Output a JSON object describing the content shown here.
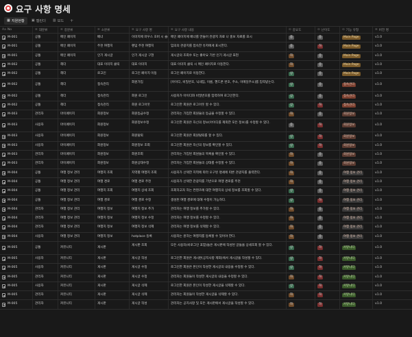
{
  "page": {
    "title": "요구 사항 명세",
    "icon": "target-icon",
    "tabs": [
      {
        "label": "지원현황",
        "icon": "table-icon",
        "active": true
      },
      {
        "label": "캘린더",
        "icon": "calendar-icon",
        "active": false
      },
      {
        "label": "보드",
        "icon": "board-icon",
        "active": false
      }
    ],
    "add_tab": "+"
  },
  "colors": {
    "background": "#191919",
    "priority": {
      "상": "#3a6b4f",
      "중": "#5a5a5a",
      "하": "#6e4a2a"
    },
    "difficulty": {
      "상": "#3a6b4f",
      "중": "#5a5a5a",
      "하": "#7a2e2e"
    },
    "category": {
      "Main Page": "#7a5a2a",
      "접속관리": "#7a3e2e",
      "회원정보": "#5a3a30",
      "여행 정보 관리": "#3a3a3a",
      "커뮤니티": "#3a5a2a"
    }
  },
  "table": {
    "columns": [
      {
        "label": "No",
        "icon": "text-icon"
      },
      {
        "label": "대분류",
        "icon": "list-icon"
      },
      {
        "label": "중분류",
        "icon": "list-icon"
      },
      {
        "label": "소분류",
        "icon": "list-icon"
      },
      {
        "label": "요구 사항 명",
        "icon": "text-icon"
      },
      {
        "label": "요구 사항 내용",
        "icon": "text-icon"
      },
      {
        "label": "중요도",
        "icon": "select-icon"
      },
      {
        "label": "난이도",
        "icon": "select-icon"
      },
      {
        "label": "기능 유형",
        "icon": "select-icon"
      },
      {
        "label": "버전 명",
        "icon": "text-icon"
      }
    ],
    "rows": [
      {
        "no": "M-001",
        "major": "공통",
        "mid": "메인 페이지",
        "minor": "배너",
        "name": "이미지에 마우스 호버 시 슬라이드 기능",
        "desc": "메인 페이지에 배너를 만들어 관광지 자료 나 홍보 자료를 표시",
        "prio": "중",
        "diff": "중",
        "type": "Main Page",
        "ver": "v1.0"
      },
      {
        "no": "M-001",
        "major": "공통",
        "mid": "메인 페이지",
        "minor": "주천 여행지",
        "name": "랜덤 주천 여행지",
        "desc": "임의의 관광지를 접속한 유저에게 표시한다.",
        "prio": "중",
        "diff": "하",
        "type": "Main Page",
        "ver": "v1.0"
      },
      {
        "no": "M-001",
        "major": "공통",
        "mid": "메인 페이지",
        "minor": "인기 게시글",
        "name": "인기 게시글 구현",
        "desc": "게시글의 조회수 또는 좋아요 기반 인기 게시글 표현",
        "prio": "하",
        "diff": "중",
        "type": "Main Page",
        "ver": "v1.0"
      },
      {
        "no": "M-002",
        "major": "공통",
        "mid": "헤더",
        "minor": "대표 이미지 클릭",
        "name": "대표 이미지",
        "desc": "대표 이미지 클릭 시 메인 페이지로 이동한다.",
        "prio": "하",
        "diff": "중",
        "type": "Main Page",
        "ver": "v1.0"
      },
      {
        "no": "M-002",
        "major": "공통",
        "mid": "헤더",
        "minor": "로고인",
        "name": "로그인 페이지 이동",
        "desc": "로그인 페이지로 이동한다.",
        "prio": "상",
        "diff": "중",
        "type": "Main Page",
        "ver": "v1.0"
      },
      {
        "no": "M-002",
        "major": "공통",
        "mid": "헤더",
        "minor": "접속관리",
        "name": "회원가입",
        "desc": "[아이디, 비밀번호, 닉네임, 이름, 핸드폰 번호, 주소, 이메일주소]를 입력받는다.",
        "prio": "상",
        "diff": "중",
        "type": "접속관리",
        "ver": "v1.0",
        "tall": true
      },
      {
        "no": "M-002",
        "major": "공통",
        "mid": "헤더",
        "minor": "접속관리",
        "name": "회원 로그인",
        "desc": "사용자가 아이디와 비밀번호를 입력하여 로그인한다.",
        "prio": "상",
        "diff": "중",
        "type": "접속관리",
        "ver": "v1.0"
      },
      {
        "no": "M-002",
        "major": "공통",
        "mid": "헤더",
        "minor": "접속관리",
        "name": "회원 로그아웃",
        "desc": "로그인한 회원은 로그아웃 할 수 있다.",
        "prio": "상",
        "diff": "하",
        "type": "접속관리",
        "ver": "v1.0"
      },
      {
        "no": "M-003",
        "major": "관리자",
        "mid": "마이페이지",
        "minor": "회원정보",
        "name": "회원등급수정",
        "desc": "관리자는 가입한 회원들의 등급을 수정할 수 있다.",
        "prio": "하",
        "diff": "중",
        "type": "회원정보",
        "ver": "v1.0"
      },
      {
        "no": "M-003",
        "major": "사용자",
        "mid": "마이페이지",
        "minor": "회원정보",
        "name": "회원정보수정",
        "desc": "로그인한 회원은 자신의 정보(아이디를 제외한 모든 정보)를 수정할 수 있다.",
        "prio": "중",
        "diff": "하",
        "type": "회원정보",
        "ver": "v1.0",
        "tall": true
      },
      {
        "no": "M-003",
        "major": "사용자",
        "mid": "마이페이지",
        "minor": "회원정보",
        "name": "회원탈퇴",
        "desc": "로그인한 회원은 회원탈퇴를 할 수 있다.",
        "prio": "상",
        "diff": "하",
        "type": "회원정보",
        "ver": "v1.0"
      },
      {
        "no": "M-003",
        "major": "사용자",
        "mid": "마이페이지",
        "minor": "회원정보",
        "name": "회원정보 조회",
        "desc": "로그인한 회원은 자신의 정보를 확인할 수 있다.",
        "prio": "상",
        "diff": "하",
        "type": "회원정보",
        "ver": "v1.0"
      },
      {
        "no": "M-003",
        "major": "관리자",
        "mid": "마이페이지",
        "minor": "회원정보",
        "name": "회원조회",
        "desc": "관리자는 가입된 회원들의 목록을 확인할 수 있다.",
        "prio": "하",
        "diff": "중",
        "type": "회원정보",
        "ver": "v1.0"
      },
      {
        "no": "M-003",
        "major": "관리자",
        "mid": "마이페이지",
        "minor": "회원정보",
        "name": "회원상태수정",
        "desc": "관리자는 가입한 회원들의 상태를 수정할 수 있다.",
        "prio": "하",
        "diff": "중",
        "type": "회원정보",
        "ver": "v1.0"
      },
      {
        "no": "M-004",
        "major": "공통",
        "mid": "여행 정보 관리",
        "minor": "여행지 조회",
        "name": "지역별 여행지 조회",
        "desc": "사용자가 선택한 지역에 따라 오구된 명세에 따른 관광지를 출력한다.",
        "prio": "하",
        "diff": "중",
        "type": "여행 정보 관리",
        "ver": "v1.0"
      },
      {
        "no": "M-004",
        "major": "공통",
        "mid": "여행 정보 관리",
        "minor": "여행 경로",
        "name": "여행 경로 주천",
        "desc": "사용자가 선택한 관광지를 기반으로 여행 경로를 주천",
        "prio": "하",
        "diff": "중",
        "type": "여행 정보 관리",
        "ver": "v1.0"
      },
      {
        "no": "M-004",
        "major": "공통",
        "mid": "여행 정보 관리",
        "minor": "여행지 조회",
        "name": "여행지 상세 조회",
        "desc": "조회하고자 하는 컨텐츠에 대한 여행지의 상세 정보를 조회할 수 있다.",
        "prio": "상",
        "diff": "중",
        "type": "여행 정보 관리",
        "ver": "v1.0"
      },
      {
        "no": "M-004",
        "major": "공통",
        "mid": "여행 정보 관리",
        "minor": "여행 경로",
        "name": "여행 경로 수정",
        "desc": "생성된 여행 경로에 대해 수정이 가능하다.",
        "prio": "상",
        "diff": "하",
        "type": "여행 정보 관리",
        "ver": "v1.0"
      },
      {
        "no": "M-004",
        "major": "관리자",
        "mid": "여행 정보 관리",
        "minor": "여행지 정보",
        "name": "여행지 정보 추가",
        "desc": "관리자는 여행 정보를 추가할 수 있다.",
        "prio": "하",
        "diff": "중",
        "type": "여행 정보 관리",
        "ver": "v1.0"
      },
      {
        "no": "M-004",
        "major": "관리자",
        "mid": "여행 정보 관리",
        "minor": "여행지 정보",
        "name": "여행지 정보 수정",
        "desc": "관리자는 여행 정보를 수정할 수 있다.",
        "prio": "하",
        "diff": "중",
        "type": "여행 정보 관리",
        "ver": "v1.0"
      },
      {
        "no": "M-004",
        "major": "관리자",
        "mid": "여행 정보 관리",
        "minor": "여행지 정보",
        "name": "여행지 정보 삭제",
        "desc": "관리자는 여행 정보를 삭제할 수 있다.",
        "prio": "하",
        "diff": "중",
        "type": "여행 정보 관리",
        "ver": "v1.0"
      },
      {
        "no": "M-004",
        "major": "사용자",
        "mid": "여행 정보 관리",
        "minor": "여행지 정보",
        "name": "hotplace 등록",
        "desc": "사용자는 원하는 여행지를 등록할 수 있어야 한다.",
        "prio": "하",
        "diff": "중",
        "type": "여행 정보 관리",
        "ver": "v1.0"
      },
      {
        "no": "M-005",
        "major": "공통",
        "mid": "커뮤니티",
        "minor": "게시판",
        "name": "게시판 조회",
        "desc": "모든 사용자(비로그인 포함)들은 게시판에 작성된 글들을 상세조회 할 수 있다.",
        "prio": "상",
        "diff": "하",
        "type": "커뮤니티",
        "ver": "v1.0",
        "tall": true
      },
      {
        "no": "M-005",
        "major": "사용자",
        "mid": "커뮤니티",
        "minor": "게시판",
        "name": "게시글 작성",
        "desc": "로그인한 회원은 게시판(공지사항 제외)에서 게시글을 작성할 수 있다.",
        "prio": "상",
        "diff": "하",
        "type": "커뮤니티",
        "ver": "v1.0"
      },
      {
        "no": "M-005",
        "major": "사용자",
        "mid": "커뮤니티",
        "minor": "게시판",
        "name": "게시글 수정",
        "desc": "로그인한 회원은 본인이 작성한 게시글의 내용을 수정할 수 있다.",
        "prio": "상",
        "diff": "하",
        "type": "커뮤니티",
        "ver": "v1.0"
      },
      {
        "no": "M-005",
        "major": "관리자",
        "mid": "커뮤니티",
        "minor": "게시판",
        "name": "게시글 수정",
        "desc": "관리자는 회원들이 작성한 게시글의 내용을 수정할 수 있다.",
        "prio": "하",
        "diff": "하",
        "type": "커뮤니티",
        "ver": "v1.0"
      },
      {
        "no": "M-005",
        "major": "사용자",
        "mid": "커뮤니티",
        "minor": "게시판",
        "name": "게시글 삭제",
        "desc": "로그인한 회원은 본인이 작성한 게시글을 삭제할 수 있다.",
        "prio": "상",
        "diff": "하",
        "type": "커뮤니티",
        "ver": "v1.0"
      },
      {
        "no": "M-005",
        "major": "관리자",
        "mid": "커뮤니티",
        "minor": "게시판",
        "name": "게시글 삭제",
        "desc": "관리자는 회원들이 작성한 게시글을 삭제할 수 있다.",
        "prio": "하",
        "diff": "하",
        "type": "커뮤니티",
        "ver": "v1.0"
      },
      {
        "no": "M-005",
        "major": "관리자",
        "mid": "커뮤니티",
        "minor": "게시판",
        "name": "게시글 작성",
        "desc": "관리자는 공지사항 및 모든 게시판에서 게시글을 작성할 수 있다.",
        "prio": "하",
        "diff": "하",
        "type": "커뮤니티",
        "ver": "v1.0"
      }
    ]
  }
}
